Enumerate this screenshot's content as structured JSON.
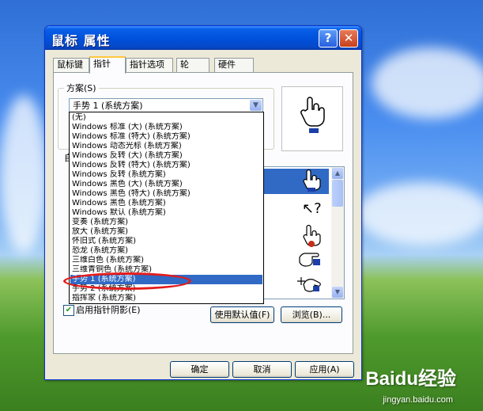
{
  "window": {
    "title": "鼠标 属性",
    "help_button": "?",
    "close_button": "✕"
  },
  "tabs": [
    {
      "label": "鼠标键"
    },
    {
      "label": "指针"
    },
    {
      "label": "指针选项"
    },
    {
      "label": "轮"
    },
    {
      "label": "硬件"
    }
  ],
  "scheme": {
    "group_label": "方案(S)",
    "selected_value": "手势 1 (系统方案)"
  },
  "customize_label": "自",
  "shadow_checkbox": {
    "label": "启用指针阴影(E)",
    "checked": true
  },
  "buttons": {
    "use_default": "使用默认值(F)",
    "browse": "浏览(B)...",
    "ok": "确定",
    "cancel": "取消",
    "apply": "应用(A)"
  },
  "scheme_options": [
    "(无)",
    "Windows 标准 (大) (系统方案)",
    "Windows 标准 (特大) (系统方案)",
    "Windows 动态光标 (系统方案)",
    "Windows 反转 (大) (系统方案)",
    "Windows 反转 (特大) (系统方案)",
    "Windows 反转 (系统方案)",
    "Windows 黑色 (大) (系统方案)",
    "Windows 黑色 (特大) (系统方案)",
    "Windows 黑色 (系统方案)",
    "Windows 默认 (系统方案)",
    "变奏 (系统方案)",
    "放大 (系统方案)",
    "怀旧式 (系统方案)",
    "恐龙 (系统方案)",
    "三维白色 (系统方案)",
    "三维青铜色 (系统方案)",
    "手势 1 (系统方案)",
    "手势 2 (系统方案)",
    "指挥家 (系统方案)"
  ],
  "selected_option_index": 17,
  "watermark": {
    "brand": "Baidu经验",
    "url": "jingyan.baidu.com"
  },
  "colors": {
    "titlebar": "#0052dd",
    "selection": "#316ac5",
    "annotation": "#e41b1b"
  }
}
